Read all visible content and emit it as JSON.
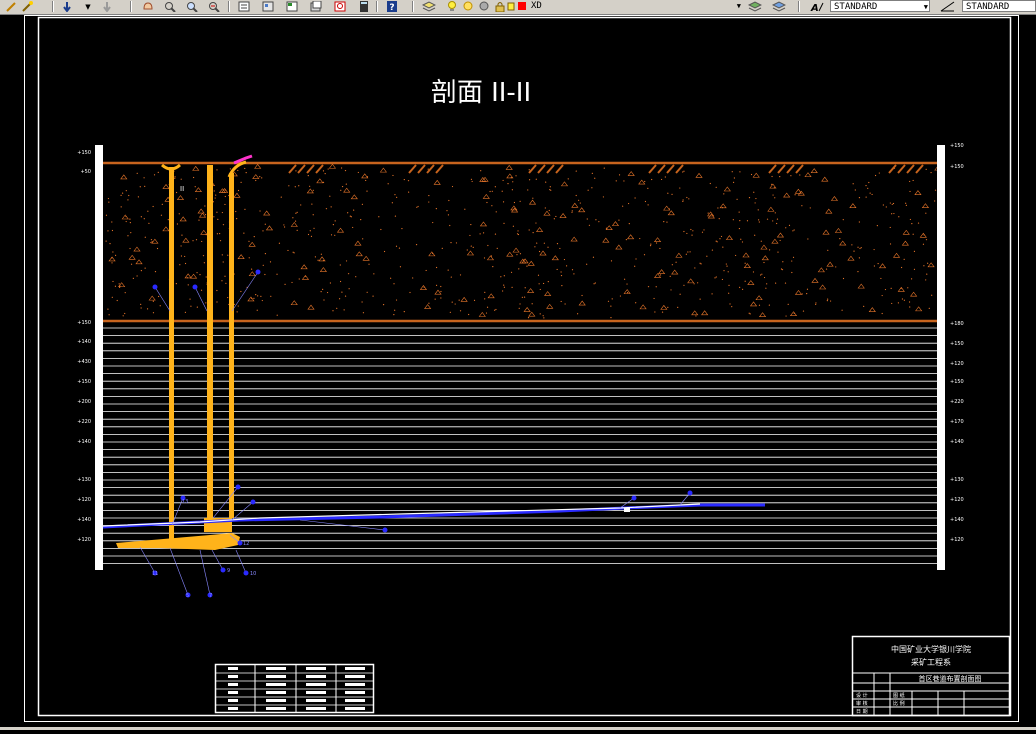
{
  "toolbar": {
    "layer_name": "XD",
    "text_style": "STANDARD",
    "dim_style": "STANDARD",
    "icons": [
      "pencil-icon",
      "brush-icon",
      "undo-icon",
      "redo-icon",
      "pan-hand-icon",
      "zoom-realtime-icon",
      "zoom-window-icon",
      "zoom-previous-icon",
      "properties-icon",
      "design-center-icon",
      "tool-palette-icon",
      "sheet-set-icon",
      "markup-icon",
      "calculator-icon",
      "help-icon",
      "layer-manager-icon",
      "bulb-icon",
      "sun-icon",
      "lock-icon",
      "color-swatch-icon",
      "layer-state-icon",
      "layer-prev-icon",
      "text-style-icon",
      "dim-style-icon"
    ]
  },
  "drawing": {
    "title": "剖面 II-II",
    "left_elevations": [
      "+150",
      "+50",
      "+150",
      "+140",
      "+430",
      "+150",
      "+200",
      "+220",
      "+140",
      "+130",
      "+120",
      "+140",
      "+120"
    ],
    "right_elevations": [
      "+150",
      "+150",
      "+180",
      "+150",
      "+120",
      "+150",
      "+220",
      "+170",
      "+140",
      "+130",
      "+120",
      "+140",
      "+120"
    ],
    "shaft_label": "II",
    "callout_labels": [
      "5",
      "7",
      "9",
      "10",
      "11",
      "12",
      "13"
    ],
    "title_block": {
      "org_line1": "中国矿业大学银川学院",
      "org_line2": "采矿工程系",
      "drawing_name": "首区巷道布置剖面图",
      "rows": [
        [
          "设 计",
          "",
          "图 纸",
          ""
        ],
        [
          "审 核",
          "",
          "比 例",
          ""
        ],
        [
          "日 期",
          "",
          "",
          ""
        ]
      ]
    },
    "legend_rows": 5,
    "colors": {
      "frame": "#ffffff",
      "soil_line": "#c8641e",
      "soil_dots": "#e8762a",
      "strata_lines": "#ffffff",
      "shaft": "#ffb31a",
      "roadway": "#2a2aff",
      "roadway_white": "#ffffff",
      "marker": "#ff33cc"
    }
  }
}
